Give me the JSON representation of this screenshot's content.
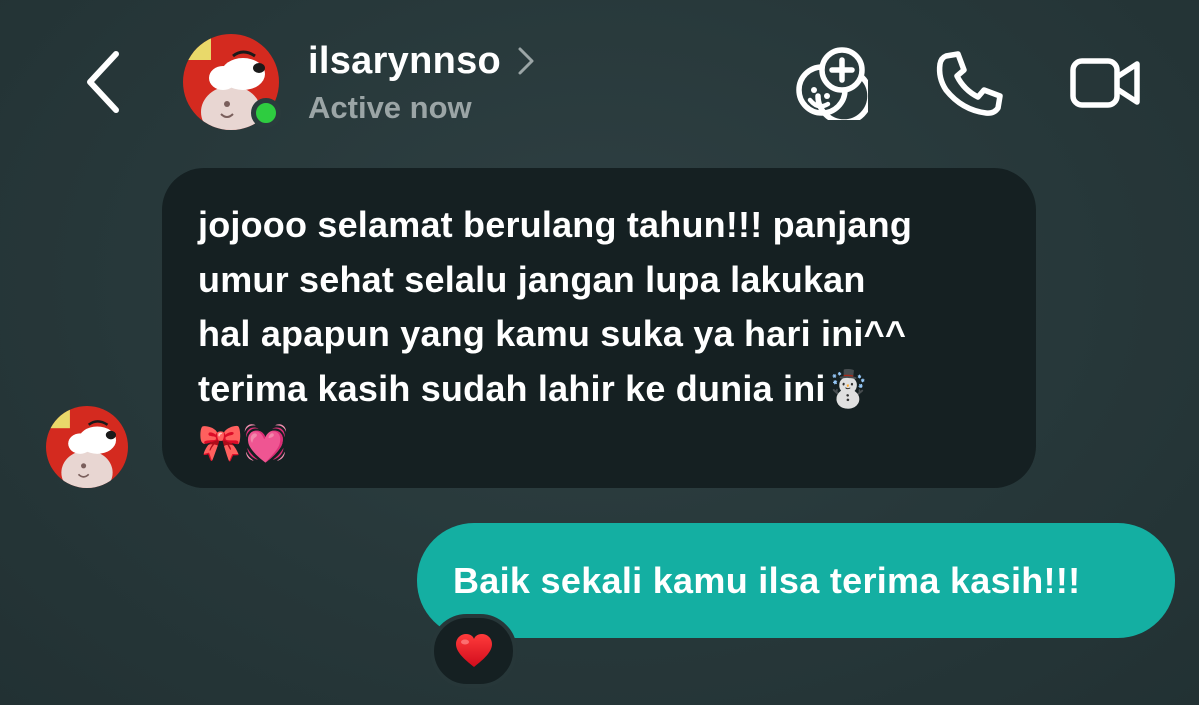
{
  "header": {
    "username": "ilsarynnso",
    "status": "Active now",
    "icons": {
      "back": "chevron-left-icon",
      "profile_link": "chevron-right-icon",
      "effects": "face-plus-icon",
      "call": "phone-icon",
      "video": "video-camera-icon"
    },
    "online_color": "#2ecc40"
  },
  "messages": [
    {
      "direction": "incoming",
      "text": "jojooo selamat berulang tahun!!! panjang\numur sehat selalu jangan lupa lakukan\nhal apapun yang kamu suka ya hari ini^^\nterima kasih sudah lahir ke dunia ini☃️\n🎀💓",
      "bubble_color": "#152022"
    },
    {
      "direction": "outgoing",
      "text": "Baik sekali kamu ilsa terima kasih!!!",
      "bubble_color": "#14afa2",
      "reaction": "❤️"
    }
  ],
  "colors": {
    "background": "#2a3b3d",
    "status_text": "#9ba5a6"
  }
}
